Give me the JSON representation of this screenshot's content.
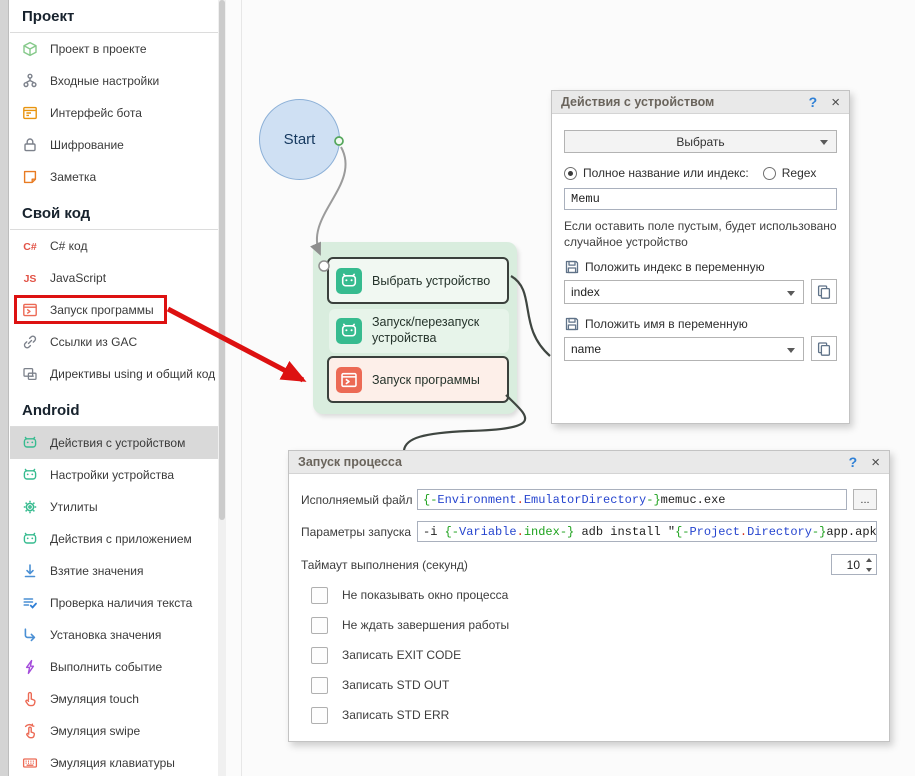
{
  "sidebar": {
    "sections": [
      {
        "title": "Проект",
        "items": [
          {
            "icon": "cube",
            "label": "Проект в проекте"
          },
          {
            "icon": "tree",
            "label": "Входные настройки"
          },
          {
            "icon": "bot-ui",
            "label": "Интерфейс бота"
          },
          {
            "icon": "lock",
            "label": "Шифрование"
          },
          {
            "icon": "note",
            "label": "Заметка"
          }
        ]
      },
      {
        "title": "Свой код",
        "items": [
          {
            "icon": "csharp",
            "label": "C# код"
          },
          {
            "icon": "js",
            "label": "JavaScript"
          },
          {
            "icon": "run-program",
            "label": "Запуск программы",
            "highlighted": true
          },
          {
            "icon": "link",
            "label": "Ссылки из GAC"
          },
          {
            "icon": "using",
            "label": "Директивы using и общий код"
          }
        ]
      },
      {
        "title": "Android",
        "items": [
          {
            "icon": "android",
            "label": "Действия с устройством",
            "selected": true
          },
          {
            "icon": "android",
            "label": "Настройки устройства"
          },
          {
            "icon": "gear",
            "label": "Утилиты"
          },
          {
            "icon": "android",
            "label": "Действия с приложением"
          },
          {
            "icon": "take-value",
            "label": "Взятие значения"
          },
          {
            "icon": "check-text",
            "label": "Проверка наличия текста"
          },
          {
            "icon": "set-value",
            "label": "Установка значения"
          },
          {
            "icon": "event",
            "label": "Выполнить событие"
          },
          {
            "icon": "touch",
            "label": "Эмуляция touch"
          },
          {
            "icon": "swipe",
            "label": "Эмуляция swipe"
          },
          {
            "icon": "keyboard",
            "label": "Эмуляция клавиатуры"
          }
        ]
      }
    ]
  },
  "canvas": {
    "start_label": "Start",
    "group_blocks": [
      {
        "icon": "android",
        "label": "Выбрать устройство"
      },
      {
        "icon": "android",
        "label": "Запуск/перезапуск устройства"
      },
      {
        "icon": "run-program",
        "label": "Запуск программы"
      }
    ]
  },
  "device_dialog": {
    "title": "Действия с устройством",
    "help_icon": "?",
    "close_icon": "×",
    "select_button": "Выбрать",
    "radio_full_name": "Полное название или индекс:",
    "radio_regex": "Regex",
    "device_value": "Memu",
    "hint": "Если оставить поле пустым, будет использовано случайное устройство",
    "index_label": "Положить индекс в переменную",
    "index_value": "index",
    "name_label": "Положить имя в переменную",
    "name_value": "name"
  },
  "process_dialog": {
    "title": "Запуск процесса",
    "help_icon": "?",
    "close_icon": "×",
    "exe_label": "Исполняемый файл",
    "exe_tokens": [
      {
        "t": "{-",
        "c": "green"
      },
      {
        "t": "Environment",
        "c": "blue"
      },
      {
        "t": ".",
        "c": "red"
      },
      {
        "t": "EmulatorDirectory",
        "c": "blue"
      },
      {
        "t": "-}",
        "c": "green"
      },
      {
        "t": "memuc.exe",
        "c": "dark"
      }
    ],
    "browse_button": "...",
    "args_label": "Параметры запуска",
    "args_tokens": [
      {
        "t": "-i ",
        "c": "dark"
      },
      {
        "t": "{-",
        "c": "green"
      },
      {
        "t": "Variable",
        "c": "blue"
      },
      {
        "t": ".",
        "c": "red"
      },
      {
        "t": "index",
        "c": "green"
      },
      {
        "t": "-}",
        "c": "green"
      },
      {
        "t": " adb install \"",
        "c": "dark"
      },
      {
        "t": "{-",
        "c": "green"
      },
      {
        "t": "Project",
        "c": "blue"
      },
      {
        "t": ".",
        "c": "red"
      },
      {
        "t": "Directory",
        "c": "blue"
      },
      {
        "t": "-}",
        "c": "green"
      },
      {
        "t": "app.apk\"",
        "c": "dark"
      }
    ],
    "timeout_label": "Таймаут выполнения (секунд)",
    "timeout_value": "10",
    "checkboxes": [
      "Не показывать окно процесса",
      "Не ждать завершения работы",
      "Записать EXIT CODE",
      "Записать STD OUT",
      "Записать STD ERR"
    ]
  },
  "colors": {
    "token_green": "#1ea21e",
    "token_blue": "#2645cf",
    "token_red": "#d8341c",
    "token_dark": "#1f1f1f",
    "accent_teal": "#36bb8f",
    "accent_red": "#ec6a55",
    "arrow_red": "#dd1111"
  }
}
